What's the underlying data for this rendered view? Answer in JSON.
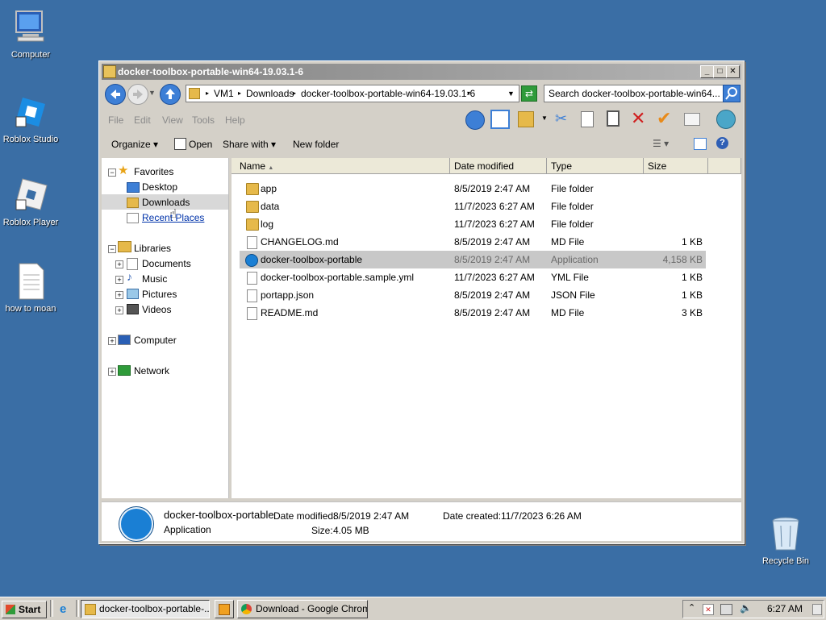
{
  "desktop": {
    "icons": [
      {
        "label": "Computer"
      },
      {
        "label": "Roblox Studio"
      },
      {
        "label": "Roblox Player"
      },
      {
        "label": "how to moan"
      },
      {
        "label": "Recycle Bin"
      }
    ]
  },
  "window": {
    "title": "docker-toolbox-portable-win64-19.03.1-6",
    "breadcrumb": [
      "VM1",
      "Downloads",
      "docker-toolbox-portable-win64-19.03.1-6"
    ],
    "search_placeholder": "Search docker-toolbox-portable-win64...",
    "menu": [
      "File",
      "Edit",
      "View",
      "Tools",
      "Help"
    ],
    "commands": {
      "organize": "Organize",
      "open": "Open",
      "share": "Share with",
      "new_folder": "New folder"
    },
    "nav": {
      "favorites": "Favorites",
      "desktop": "Desktop",
      "downloads": "Downloads",
      "recent": "Recent Places",
      "libraries": "Libraries",
      "documents": "Documents",
      "music": "Music",
      "pictures": "Pictures",
      "videos": "Videos",
      "computer": "Computer",
      "network": "Network"
    },
    "columns": {
      "name": "Name",
      "date": "Date modified",
      "type": "Type",
      "size": "Size"
    },
    "files": [
      {
        "name": "app",
        "date": "8/5/2019 2:47 AM",
        "type": "File folder",
        "size": ""
      },
      {
        "name": "data",
        "date": "11/7/2023 6:27 AM",
        "type": "File folder",
        "size": ""
      },
      {
        "name": "log",
        "date": "11/7/2023 6:27 AM",
        "type": "File folder",
        "size": ""
      },
      {
        "name": "CHANGELOG.md",
        "date": "8/5/2019 2:47 AM",
        "type": "MD File",
        "size": "1 KB"
      },
      {
        "name": "docker-toolbox-portable",
        "date": "8/5/2019 2:47 AM",
        "type": "Application",
        "size": "4,158 KB"
      },
      {
        "name": "docker-toolbox-portable.sample.yml",
        "date": "11/7/2023 6:27 AM",
        "type": "YML File",
        "size": "1 KB"
      },
      {
        "name": "portapp.json",
        "date": "8/5/2019 2:47 AM",
        "type": "JSON File",
        "size": "1 KB"
      },
      {
        "name": "README.md",
        "date": "8/5/2019 2:47 AM",
        "type": "MD File",
        "size": "3 KB"
      }
    ],
    "details": {
      "name": "docker-toolbox-portable",
      "kind": "Application",
      "modified_label": "Date modified:",
      "modified": "8/5/2019 2:47 AM",
      "created_label": "Date created:",
      "created": "11/7/2023 6:26 AM",
      "size_label": "Size:",
      "size": "4.05 MB"
    }
  },
  "taskbar": {
    "start": "Start",
    "tasks": [
      "docker-toolbox-portable-...",
      "Download - Google Chrome"
    ],
    "clock": "6:27 AM"
  }
}
